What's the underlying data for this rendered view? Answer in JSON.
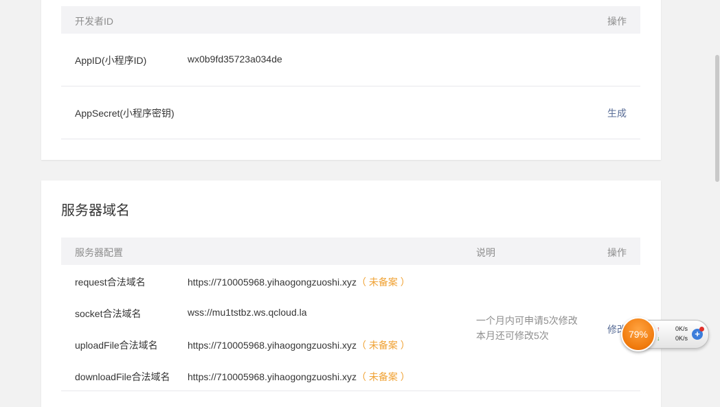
{
  "developer": {
    "header_left": "开发者ID",
    "header_right": "操作",
    "rows": [
      {
        "label": "AppID(小程序ID)",
        "value": "wx0b9fd35723a034de",
        "action": ""
      },
      {
        "label": "AppSecret(小程序密钥)",
        "value": "",
        "action": "生成"
      }
    ]
  },
  "server": {
    "title": "服务器域名",
    "header_config": "服务器配置",
    "header_desc": "说明",
    "header_action": "操作",
    "domains": [
      {
        "label": "request合法域名",
        "value": "https://710005968.yihaogongzuoshi.xyz",
        "badge": "（ 未备案 ）"
      },
      {
        "label": "socket合法域名",
        "value": "wss://mu1tstbz.ws.qcloud.la",
        "badge": ""
      },
      {
        "label": "uploadFile合法域名",
        "value": "https://710005968.yihaogongzuoshi.xyz",
        "badge": "（ 未备案 ）"
      },
      {
        "label": "downloadFile合法域名",
        "value": "https://710005968.yihaogongzuoshi.xyz",
        "badge": "（ 未备案 ）"
      }
    ],
    "note_line1": "一个月内可申请5次修改",
    "note_line2": "本月还可修改5次",
    "modify_link": "修改"
  },
  "widget": {
    "percent": "79%",
    "up_speed": "0K/s",
    "down_speed": "0K/s",
    "up_arrow": "↑",
    "down_arrow": "↓",
    "plus": "+"
  }
}
